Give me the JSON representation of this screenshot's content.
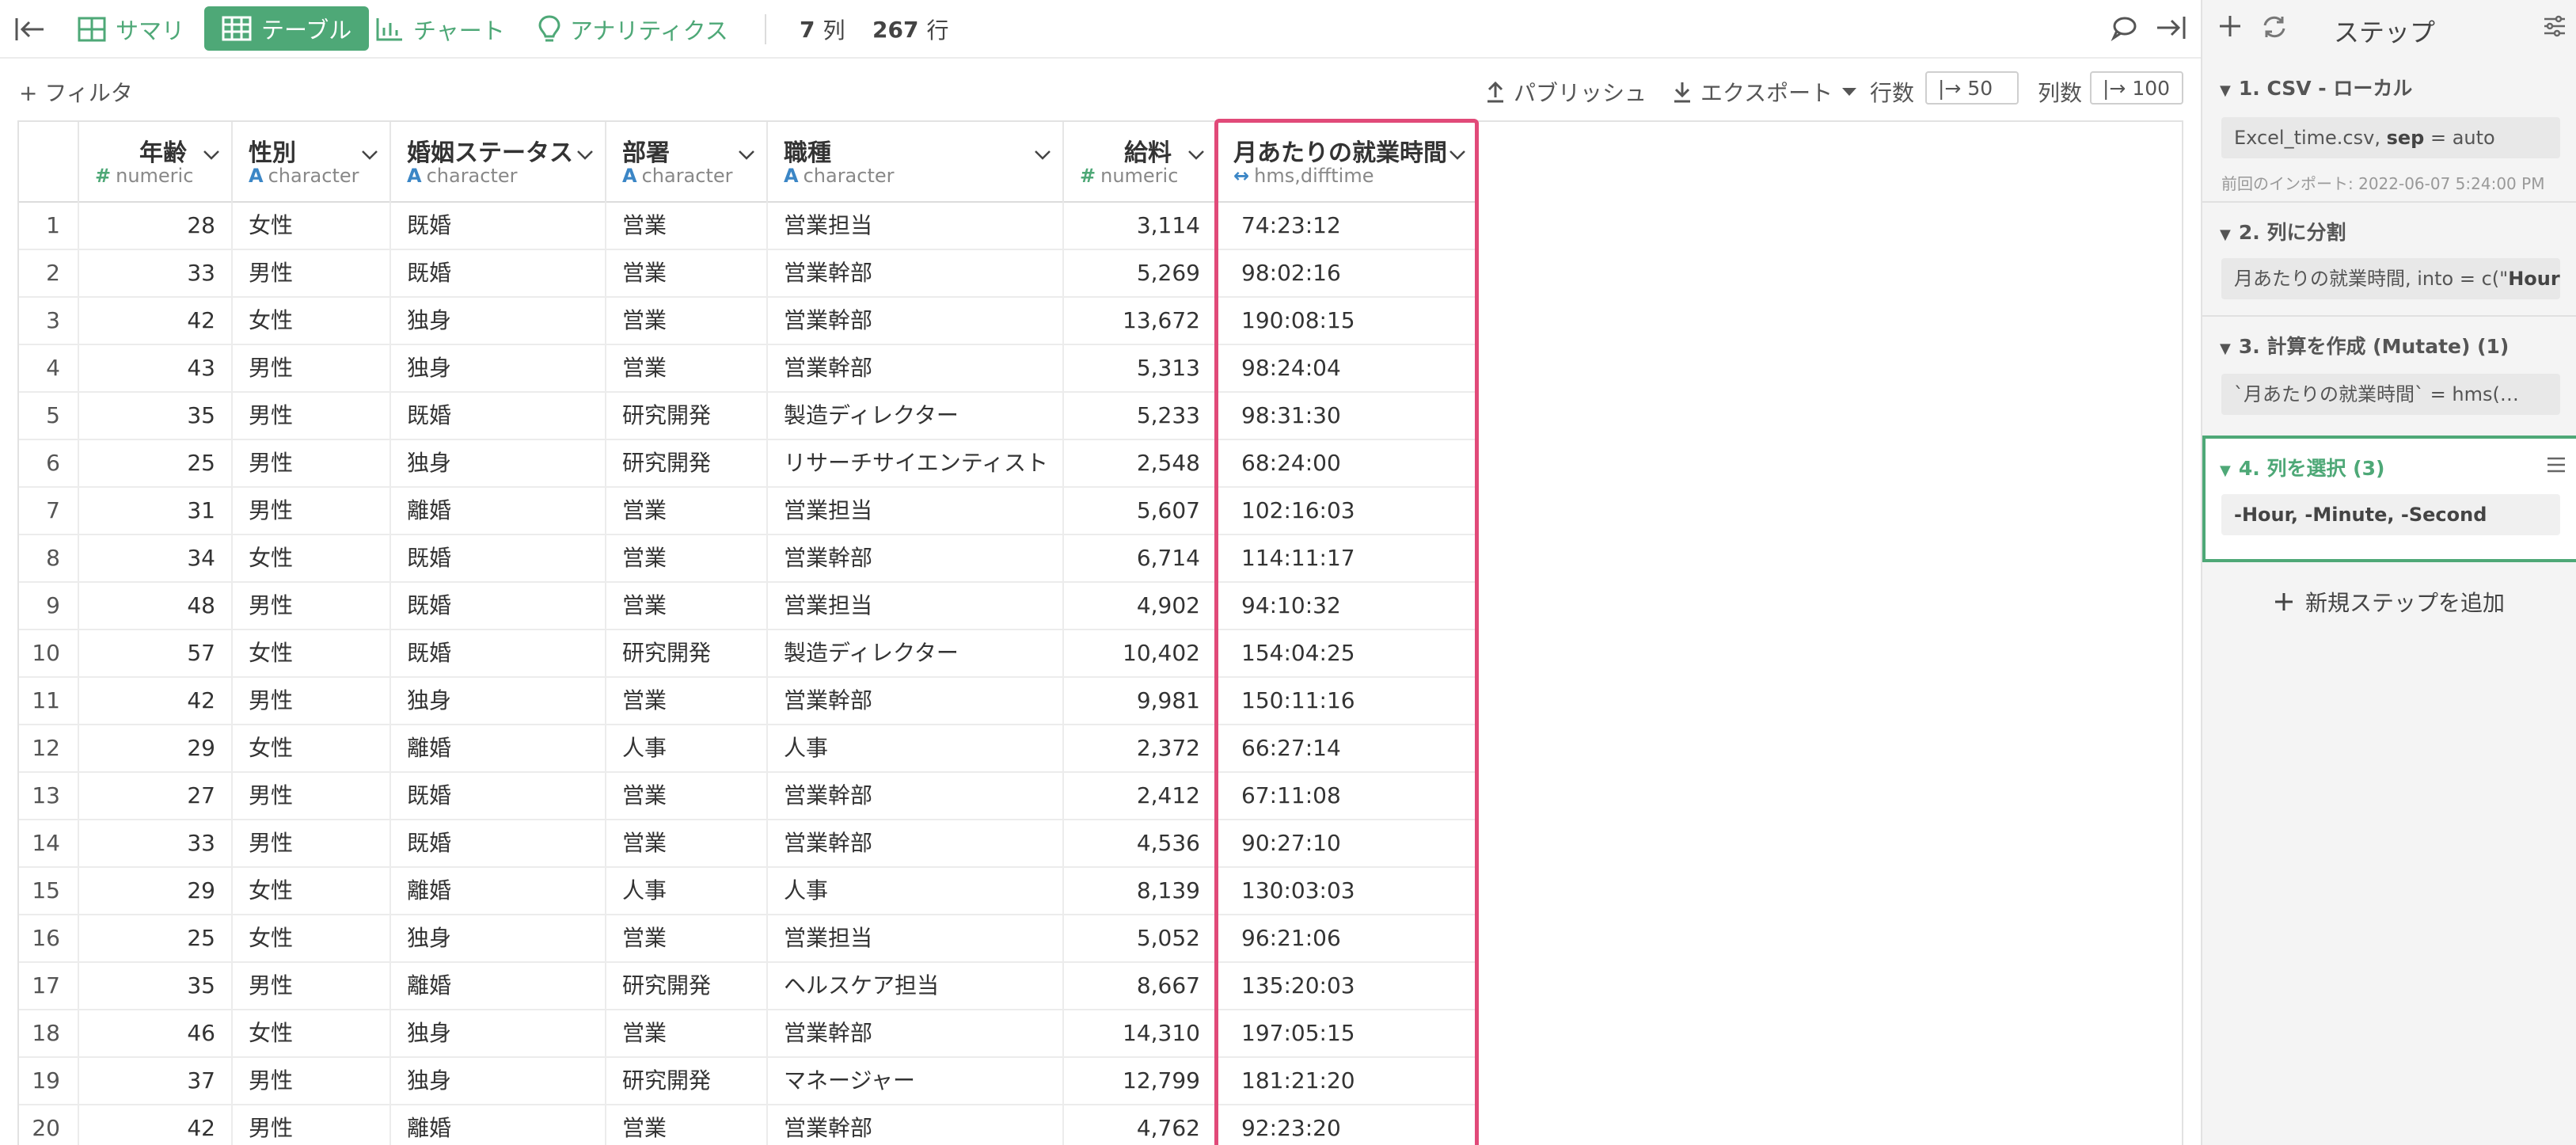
{
  "toolbar": {
    "summary": "サマリ",
    "table": "テーブル",
    "chart": "チャート",
    "analytics": "アナリティクス",
    "cols_count": "7",
    "cols_unit": "列",
    "rows_count": "267",
    "rows_unit": "行"
  },
  "subbar": {
    "filter": "+ フィルタ",
    "publish": "パブリッシュ",
    "export": "エクスポート",
    "rows_label": "行数",
    "rows_value": "|→ 50",
    "cols_label": "列数",
    "cols_value": "|→ 100"
  },
  "columns": [
    {
      "name": "年齢",
      "type": "numeric",
      "type_icon": "#"
    },
    {
      "name": "性別",
      "type": "character",
      "type_icon": "A"
    },
    {
      "name": "婚姻ステータス",
      "type": "character",
      "type_icon": "A"
    },
    {
      "name": "部署",
      "type": "character",
      "type_icon": "A"
    },
    {
      "name": "職種",
      "type": "character",
      "type_icon": "A"
    },
    {
      "name": "給料",
      "type": "numeric",
      "type_icon": "#"
    },
    {
      "name": "月あたりの就業時間",
      "type": "hms,difftime",
      "type_icon": "↔"
    }
  ],
  "rows": [
    [
      "1",
      "28",
      "女性",
      "既婚",
      "営業",
      "営業担当",
      "3,114",
      "74:23:12"
    ],
    [
      "2",
      "33",
      "男性",
      "既婚",
      "営業",
      "営業幹部",
      "5,269",
      "98:02:16"
    ],
    [
      "3",
      "42",
      "女性",
      "独身",
      "営業",
      "営業幹部",
      "13,672",
      "190:08:15"
    ],
    [
      "4",
      "43",
      "男性",
      "独身",
      "営業",
      "営業幹部",
      "5,313",
      "98:24:04"
    ],
    [
      "5",
      "35",
      "男性",
      "既婚",
      "研究開発",
      "製造ディレクター",
      "5,233",
      "98:31:30"
    ],
    [
      "6",
      "25",
      "男性",
      "独身",
      "研究開発",
      "リサーチサイエンティスト",
      "2,548",
      "68:24:00"
    ],
    [
      "7",
      "31",
      "男性",
      "離婚",
      "営業",
      "営業担当",
      "5,607",
      "102:16:03"
    ],
    [
      "8",
      "34",
      "女性",
      "既婚",
      "営業",
      "営業幹部",
      "6,714",
      "114:11:17"
    ],
    [
      "9",
      "48",
      "男性",
      "既婚",
      "営業",
      "営業担当",
      "4,902",
      "94:10:32"
    ],
    [
      "10",
      "57",
      "女性",
      "既婚",
      "研究開発",
      "製造ディレクター",
      "10,402",
      "154:04:25"
    ],
    [
      "11",
      "42",
      "男性",
      "独身",
      "営業",
      "営業幹部",
      "9,981",
      "150:11:16"
    ],
    [
      "12",
      "29",
      "女性",
      "離婚",
      "人事",
      "人事",
      "2,372",
      "66:27:14"
    ],
    [
      "13",
      "27",
      "男性",
      "既婚",
      "営業",
      "営業幹部",
      "2,412",
      "67:11:08"
    ],
    [
      "14",
      "33",
      "男性",
      "既婚",
      "営業",
      "営業幹部",
      "4,536",
      "90:27:10"
    ],
    [
      "15",
      "29",
      "女性",
      "離婚",
      "人事",
      "人事",
      "8,139",
      "130:03:03"
    ],
    [
      "16",
      "25",
      "女性",
      "独身",
      "営業",
      "営業担当",
      "5,052",
      "96:21:06"
    ],
    [
      "17",
      "35",
      "男性",
      "離婚",
      "研究開発",
      "ヘルスケア担当",
      "8,667",
      "135:20:03"
    ],
    [
      "18",
      "46",
      "女性",
      "独身",
      "営業",
      "営業幹部",
      "14,310",
      "197:05:15"
    ],
    [
      "19",
      "37",
      "男性",
      "独身",
      "研究開発",
      "マネージャー",
      "12,799",
      "181:21:20"
    ],
    [
      "20",
      "42",
      "男性",
      "離婚",
      "営業",
      "営業幹部",
      "4,762",
      "92:23:20"
    ]
  ],
  "panel": {
    "title": "ステップ",
    "steps": [
      {
        "title": "1. CSV - ローカル",
        "detail_pre": "Excel_time.csv, ",
        "detail_bold": "sep",
        "detail_post": " = auto",
        "note": "前回のインポート: 2022-06-07 5:24:00 PM"
      },
      {
        "title": "2. 列に分割",
        "detail_pre": "月あたりの就業時間, into = c(\"",
        "detail_bold": "Hour…",
        "detail_post": ""
      },
      {
        "title": "3. 計算を作成 (Mutate) (1)",
        "detail_pre": "`月あたりの就業時間` = hms(…",
        "detail_bold": "",
        "detail_post": ""
      },
      {
        "title": "4. 列を選択 (3)",
        "detail_pre": "",
        "detail_bold": "-Hour, -Minute, -Second",
        "detail_post": ""
      }
    ],
    "add_step": "新規ステップを追加"
  },
  "colors": {
    "accent": "#4ea877",
    "highlight": "#e14a79",
    "type_blue": "#3b86c6"
  }
}
